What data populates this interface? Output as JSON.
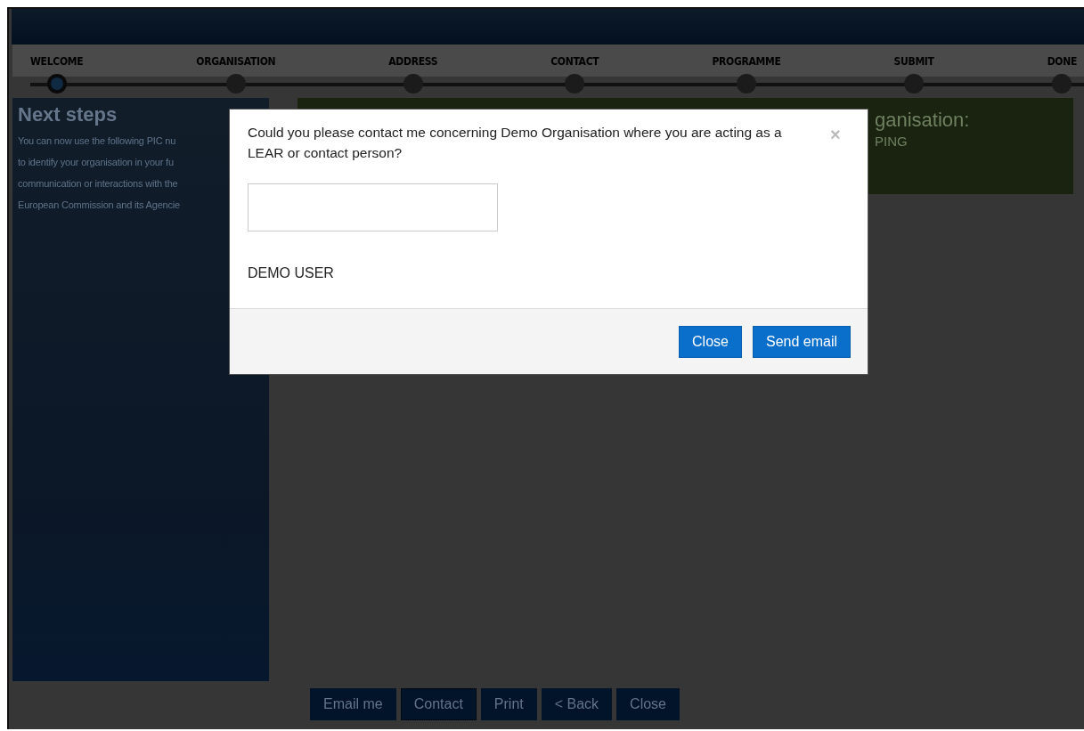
{
  "steps": [
    {
      "label": "WELCOME",
      "selected": true
    },
    {
      "label": "ORGANISATION",
      "selected": false
    },
    {
      "label": "ADDRESS",
      "selected": false
    },
    {
      "label": "CONTACT",
      "selected": false
    },
    {
      "label": "PROGRAMME",
      "selected": false
    },
    {
      "label": "SUBMIT",
      "selected": false
    },
    {
      "label": "DONE",
      "selected": false
    }
  ],
  "sidebar": {
    "title": "Next steps",
    "lines": [
      "You can now use the following PIC nu",
      "to identify your organisation in your fu",
      "communication or interactions with the",
      "European Commission and its Agencie"
    ]
  },
  "panel": {
    "title": "ganisation:",
    "subtitle": "PING"
  },
  "actions": [
    {
      "label": "Email me",
      "focused": false
    },
    {
      "label": "Contact",
      "focused": true
    },
    {
      "label": "Print",
      "focused": false
    },
    {
      "label": "< Back",
      "focused": false
    },
    {
      "label": "Close",
      "focused": false
    }
  ],
  "dialog": {
    "message": "Could you please contact me concerning Demo Organisation where you are acting as a LEAR or contact person?",
    "close_symbol": "×",
    "sender": "DEMO USER",
    "buttons": [
      "Close",
      "Send email"
    ]
  }
}
